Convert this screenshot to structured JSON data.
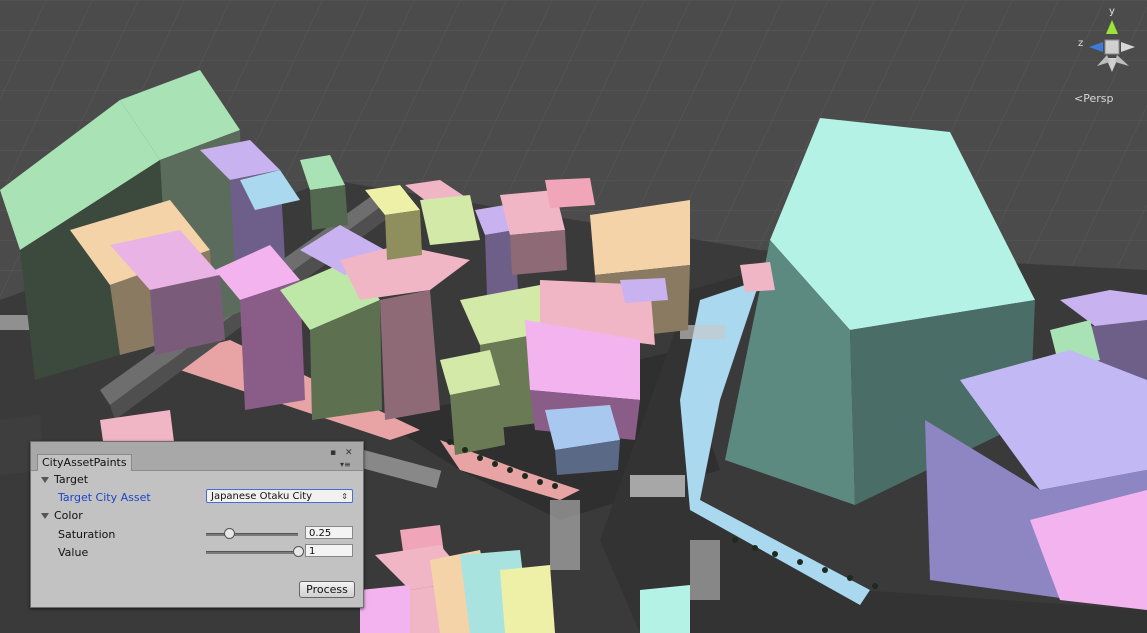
{
  "scene": {
    "view_mode": "Persp",
    "axis_labels": {
      "y": "y",
      "z": "z"
    }
  },
  "panel": {
    "tab_title": "CityAssetPaints",
    "sections": {
      "target": "Target",
      "color": "Color"
    },
    "fields": {
      "target_city_asset_label": "Target City Asset",
      "target_city_asset_value": "Japanese Otaku City",
      "saturation_label": "Saturation",
      "saturation_value": "0.25",
      "value_label": "Value",
      "value_value": "1"
    },
    "sliders": {
      "saturation_fraction": 0.25,
      "value_fraction": 1
    },
    "process_button": "Process"
  }
}
